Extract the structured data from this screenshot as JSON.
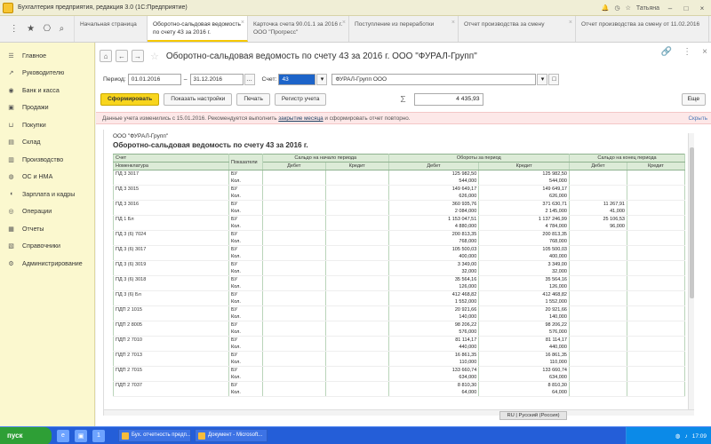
{
  "window": {
    "title": "Бухгалтерия предприятия, редакция 3.0 (1С:Предприятие)",
    "user": "Татьяна"
  },
  "tabs": [
    {
      "label": "Начальная страница",
      "active": false
    },
    {
      "label": "Оборотно-сальдовая ведомость по счету 43 за 2016 г.",
      "active": true
    },
    {
      "label": "Карточка счета 90.01.1 за 2016 г. ООО \"Прогресс\"",
      "active": false
    },
    {
      "label": "Поступление из переработки",
      "active": false
    },
    {
      "label": "Отчет производства за смену",
      "active": false
    },
    {
      "label": "Отчет производства за смену от 11.02.2016",
      "active": false
    }
  ],
  "sidebar": [
    {
      "label": "Главное",
      "icon": "grid-icon"
    },
    {
      "label": "Руководителю",
      "icon": "chart-icon"
    },
    {
      "label": "Банк и касса",
      "icon": "bank-icon"
    },
    {
      "label": "Продажи",
      "icon": "cart-icon"
    },
    {
      "label": "Покупки",
      "icon": "basket-icon"
    },
    {
      "label": "Склад",
      "icon": "box-icon"
    },
    {
      "label": "Производство",
      "icon": "factory-icon"
    },
    {
      "label": "ОС и НМА",
      "icon": "assets-icon"
    },
    {
      "label": "Зарплата и кадры",
      "icon": "people-icon"
    },
    {
      "label": "Операции",
      "icon": "operations-icon"
    },
    {
      "label": "Отчеты",
      "icon": "report-icon"
    },
    {
      "label": "Справочники",
      "icon": "book-icon"
    },
    {
      "label": "Администрирование",
      "icon": "gear-icon"
    }
  ],
  "document": {
    "title": "Оборотно-сальдовая ведомость по счету 43 за 2016 г. ООО \"ФУРАЛ-Групп\""
  },
  "params": {
    "period_label": "Период:",
    "date_from": "01.01.2016",
    "date_to": "31.12.2016",
    "account_label": "Счет:",
    "account": "43",
    "organization": "ФУРАЛ-Групп ООО"
  },
  "actions": {
    "generate": "Сформировать",
    "settings": "Показать настройки",
    "print": "Печать",
    "register": "Регистр учета",
    "sum": "4 435,93",
    "more": "Еще"
  },
  "notice": {
    "text": "Данные учета изменились с 15.01.2016. Рекомендуется выполнить ",
    "link": "закрытие месяца",
    "tail": " и сформировать отчет повторно.",
    "close": "Скрыть"
  },
  "report": {
    "org": "ООО \"ФУРАЛ-Групп\"",
    "title": "Оборотно-сальдовая ведомость по счету 43 за 2016 г.",
    "headers": {
      "account": "Счет",
      "nomenclature": "Номенклатура",
      "indicator": "Показатели",
      "opening": "Сальдо на начало периода",
      "turnover": "Обороты за период",
      "closing": "Сальдо на конец периода",
      "debit": "Дебет",
      "credit": "Кредит"
    },
    "rows": [
      [
        "ПД 3 3017",
        "БУ",
        "",
        "",
        "125 982,50",
        "125 982,50",
        "",
        ""
      ],
      [
        "",
        "Кол.",
        "",
        "",
        "544,000",
        "544,000",
        "",
        ""
      ],
      [
        "ПД 3 3015",
        "БУ",
        "",
        "",
        "149 649,17",
        "149 649,17",
        "",
        ""
      ],
      [
        "",
        "Кол.",
        "",
        "",
        "626,000",
        "626,000",
        "",
        ""
      ],
      [
        "ПД 3 3016",
        "БУ",
        "",
        "",
        "360 935,76",
        "371 630,71",
        "11 267,91",
        ""
      ],
      [
        "",
        "Кол.",
        "",
        "",
        "2 084,000",
        "2 145,000",
        "41,000",
        ""
      ],
      [
        "ПД 1 Бл",
        "БУ",
        "",
        "",
        "1 153 047,51",
        "1 137 246,99",
        "25 106,53",
        ""
      ],
      [
        "",
        "Кол.",
        "",
        "",
        "4 880,000",
        "4 784,000",
        "96,000",
        ""
      ],
      [
        "ПД 3 (6) 7024",
        "БУ",
        "",
        "",
        "200 813,35",
        "200 813,35",
        "",
        ""
      ],
      [
        "",
        "Кол.",
        "",
        "",
        "768,000",
        "768,000",
        "",
        ""
      ],
      [
        "ПД 3 (6) 3017",
        "БУ",
        "",
        "",
        "105 500,03",
        "105 500,03",
        "",
        ""
      ],
      [
        "",
        "Кол.",
        "",
        "",
        "400,000",
        "400,000",
        "",
        ""
      ],
      [
        "ПД 3 (6) 3019",
        "БУ",
        "",
        "",
        "3 349,00",
        "3 349,00",
        "",
        ""
      ],
      [
        "",
        "Кол.",
        "",
        "",
        "32,000",
        "32,000",
        "",
        ""
      ],
      [
        "ПД 3 (6) 3018",
        "БУ",
        "",
        "",
        "35 564,16",
        "35 564,16",
        "",
        ""
      ],
      [
        "",
        "Кол.",
        "",
        "",
        "126,000",
        "126,000",
        "",
        ""
      ],
      [
        "ПД 3 (6) Бл",
        "БУ",
        "",
        "",
        "412 468,82",
        "412 468,82",
        "",
        ""
      ],
      [
        "",
        "Кол.",
        "",
        "",
        "1 552,000",
        "1 552,000",
        "",
        ""
      ],
      [
        "ПДП 2 1015",
        "БУ",
        "",
        "",
        "20 921,66",
        "20 921,66",
        "",
        ""
      ],
      [
        "",
        "Кол.",
        "",
        "",
        "140,000",
        "140,000",
        "",
        ""
      ],
      [
        "ПДП 2 8005",
        "БУ",
        "",
        "",
        "98 206,22",
        "98 206,22",
        "",
        ""
      ],
      [
        "",
        "Кол.",
        "",
        "",
        "576,000",
        "576,000",
        "",
        ""
      ],
      [
        "ПДП 2 7010",
        "БУ",
        "",
        "",
        "81 114,17",
        "81 114,17",
        "",
        ""
      ],
      [
        "",
        "Кол.",
        "",
        "",
        "440,000",
        "440,000",
        "",
        ""
      ],
      [
        "ПДП 2 7013",
        "БУ",
        "",
        "",
        "16 861,35",
        "16 861,35",
        "",
        ""
      ],
      [
        "",
        "Кол.",
        "",
        "",
        "110,000",
        "110,000",
        "",
        ""
      ],
      [
        "ПДП 2 7015",
        "БУ",
        "",
        "",
        "133 660,74",
        "133 660,74",
        "",
        ""
      ],
      [
        "",
        "Кол.",
        "",
        "",
        "634,000",
        "634,000",
        "",
        ""
      ],
      [
        "ПДП 2 7037",
        "БУ",
        "",
        "",
        "8 810,30",
        "8 810,30",
        "",
        ""
      ],
      [
        "",
        "Кол.",
        "",
        "",
        "64,000",
        "64,000",
        "",
        ""
      ]
    ]
  },
  "status": {
    "mode": "RU | Русский (Россия)"
  },
  "taskbar": {
    "start": "пуск",
    "tasks": [
      "Бух. отчетность предп...",
      "Документ - Microsoft..."
    ],
    "clock": "17:09"
  }
}
